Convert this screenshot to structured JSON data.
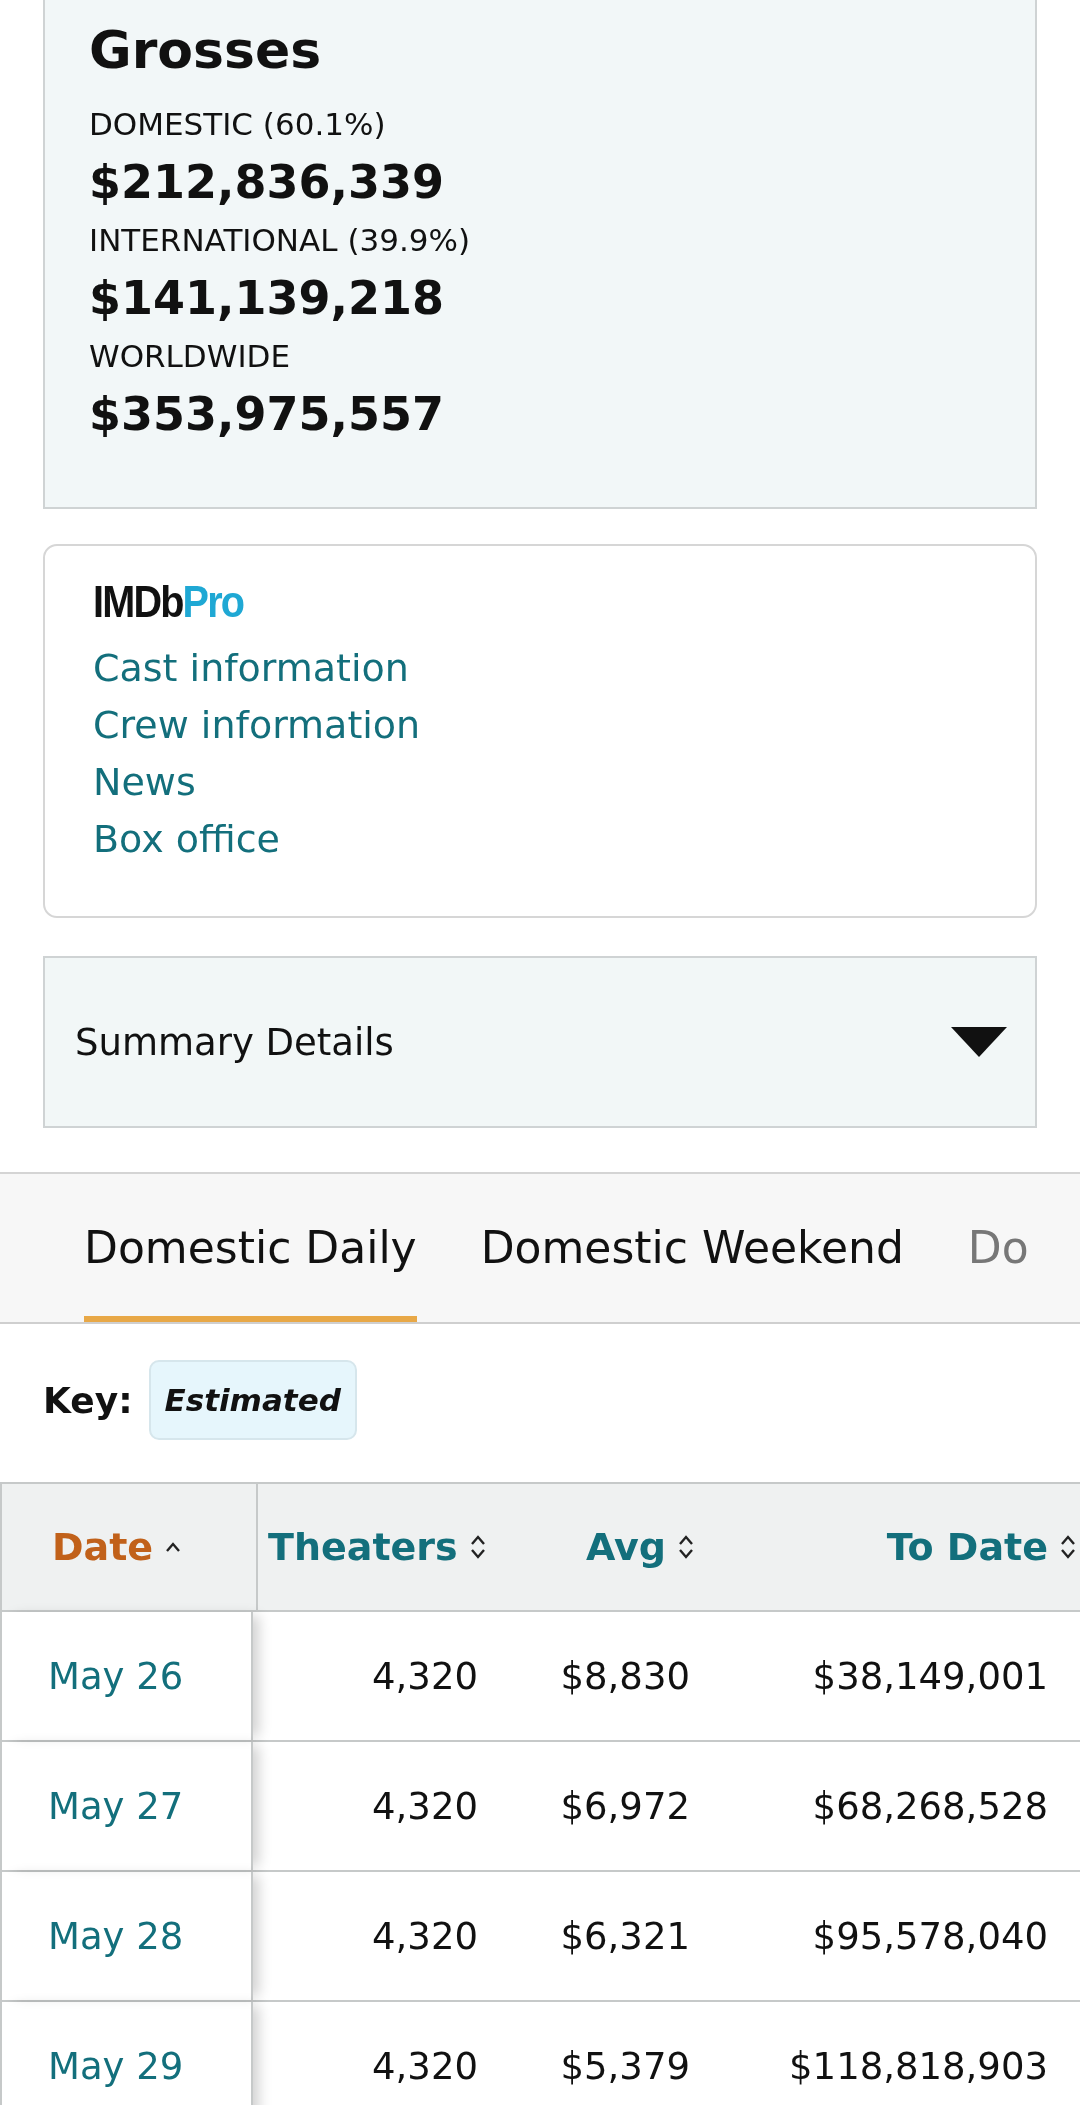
{
  "grosses": {
    "title": "Grosses",
    "items": [
      {
        "label": "DOMESTIC (60.1%)",
        "amount": "$212,836,339"
      },
      {
        "label": "INTERNATIONAL (39.9%)",
        "amount": "$141,139,218"
      },
      {
        "label": "WORLDWIDE",
        "amount": "$353,975,557"
      }
    ]
  },
  "imdbpro": {
    "logo_main": "IMDb",
    "logo_pro": "Pro",
    "links": [
      "Cast information",
      "Crew information",
      "News",
      "Box office"
    ]
  },
  "summary": {
    "label": "Summary Details",
    "expanded": false
  },
  "tabs": [
    {
      "label": "Domestic Daily",
      "selected": true
    },
    {
      "label": "Domestic Weekend",
      "selected": false
    },
    {
      "label": "Do",
      "selected": false
    }
  ],
  "key": {
    "label": "Key:",
    "badge": "Estimated"
  },
  "table": {
    "columns": [
      {
        "label": "Date",
        "sorted": true
      },
      {
        "label": "Theaters",
        "sorted": false
      },
      {
        "label": "Avg",
        "sorted": false
      },
      {
        "label": "To Date",
        "sorted": false
      }
    ],
    "rows": [
      {
        "date": "May 26",
        "theaters": "4,320",
        "avg": "$8,830",
        "to_date": "$38,149,001"
      },
      {
        "date": "May 27",
        "theaters": "4,320",
        "avg": "$6,972",
        "to_date": "$68,268,528"
      },
      {
        "date": "May 28",
        "theaters": "4,320",
        "avg": "$6,321",
        "to_date": "$95,578,040"
      },
      {
        "date": "May 29",
        "theaters": "4,320",
        "avg": "$5,379",
        "to_date": "$118,818,903"
      }
    ]
  }
}
